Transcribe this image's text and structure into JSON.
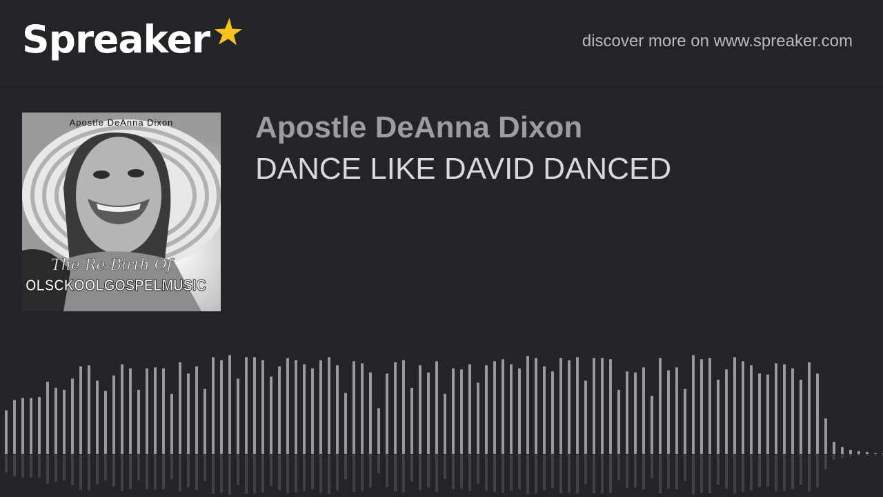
{
  "brand": {
    "name": "Spreaker"
  },
  "header": {
    "discover_text": "discover more on www.spreaker.com"
  },
  "episode": {
    "author": "Apostle DeAnna Dixon",
    "title": "DANCE LIKE DAVID DANCED"
  },
  "cover_art": {
    "top_text": "Apostle DeAnna Dixon",
    "script_text": "The Re-Birth Of",
    "bold_text": "OLSCKOOLGOSPELMUSIC"
  },
  "waveform": {
    "color": "#9a9a9a",
    "played_levels": [
      0.43,
      0.53,
      0.55,
      0.55,
      0.56,
      0.71,
      0.65,
      0.63,
      0.74,
      0.86,
      0.87,
      0.72,
      0.62,
      0.77,
      0.88,
      0.84,
      0.63,
      0.84,
      0.85,
      0.84,
      0.59,
      0.9,
      0.79,
      0.86,
      0.64,
      0.95,
      0.92,
      0.97,
      0.74,
      0.95,
      0.95,
      0.92,
      0.76,
      0.86,
      0.94,
      0.92,
      0.88,
      0.84,
      0.92,
      0.95,
      0.87,
      0.6,
      0.91,
      0.89,
      0.8,
      0.45,
      0.79,
      0.9,
      0.92,
      0.65,
      0.87,
      0.8,
      0.91,
      0.59,
      0.84,
      0.83,
      0.88,
      0.7,
      0.87,
      0.91,
      0.93,
      0.88,
      0.84,
      0.96,
      0.94,
      0.86,
      0.81,
      0.94,
      0.92,
      0.95,
      0.72,
      0.94,
      0.94,
      0.93,
      0.63,
      0.81,
      0.8,
      0.85,
      0.57,
      0.94,
      0.82,
      0.85,
      0.64,
      0.97,
      0.93,
      0.94,
      0.73,
      0.83,
      0.95,
      0.91,
      0.87,
      0.79,
      0.78,
      0.89,
      0.88,
      0.84,
      0.73,
      0.9,
      0.79,
      0.35,
      0.12,
      0.07,
      0.04,
      0.03,
      0.02,
      0.01,
      0.01,
      0.01
    ]
  }
}
